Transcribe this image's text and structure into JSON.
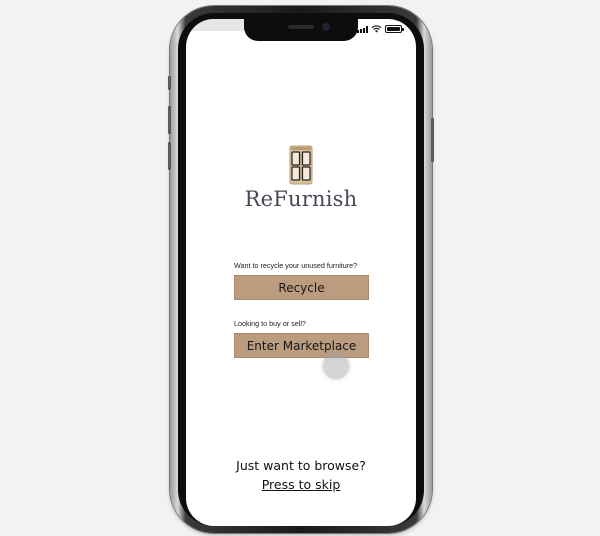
{
  "app": {
    "name": "ReFurnish",
    "logo_icon": "wardrobe-icon",
    "accent_color": "#bc9c7f"
  },
  "recycle": {
    "prompt": "Want to recycle your unused furniture?",
    "button_label": "Recycle"
  },
  "marketplace": {
    "prompt": "Looking to buy or sell?",
    "button_label": "Enter Marketplace"
  },
  "browse": {
    "prompt": "Just want to browse?",
    "skip_label": "Press to skip"
  },
  "status_bar": {
    "icons": [
      "cellular-signal-icon",
      "wifi-icon",
      "battery-icon"
    ]
  }
}
